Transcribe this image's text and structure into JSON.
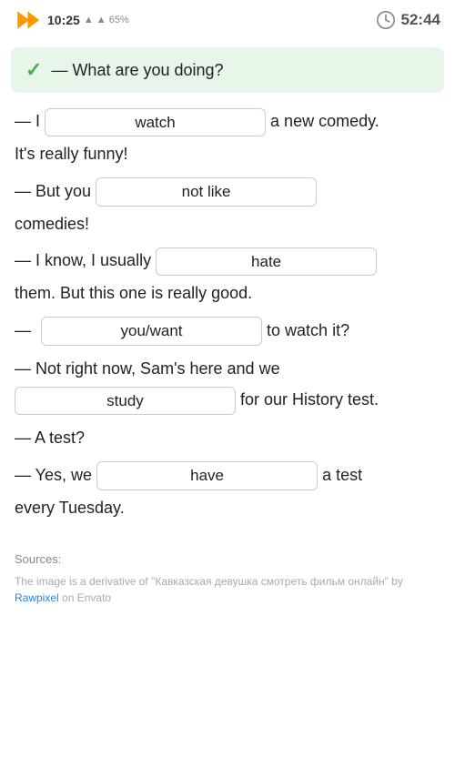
{
  "statusBar": {
    "timeLeft": "10:25",
    "timer": "52:44"
  },
  "questionBlock": {
    "checkmark": "✓",
    "text": "— What are you doing?"
  },
  "content": {
    "line1_prefix": "— I",
    "input1": "watch",
    "line1_suffix": "a new comedy.",
    "line2": "It's really funny!",
    "line3_prefix": "— But you",
    "input2": "not like",
    "line3_suffix": "comedies!",
    "line4_prefix": "— I know, I usually",
    "input3": "hate",
    "line4_suffix": "them. But this one is really good.",
    "line5_prefix": "—",
    "input4": "you/want",
    "line5_suffix": "to watch it?",
    "line6": "— Not right now, Sam's here and we",
    "input5": "study",
    "line6_suffix": "for our History test.",
    "line7": "— A test?",
    "line8_prefix": "— Yes, we",
    "input6": "have",
    "line8_suffix": "a test",
    "line9": "every Tuesday.",
    "sourcesLabel": "Sources:",
    "sourcesText": "The image is a derivative of \"Кавказская девушка смотреть фильм онлайн\" by",
    "sourcesLink": "Rawpixel",
    "sourcesEnd": "on Envato"
  }
}
